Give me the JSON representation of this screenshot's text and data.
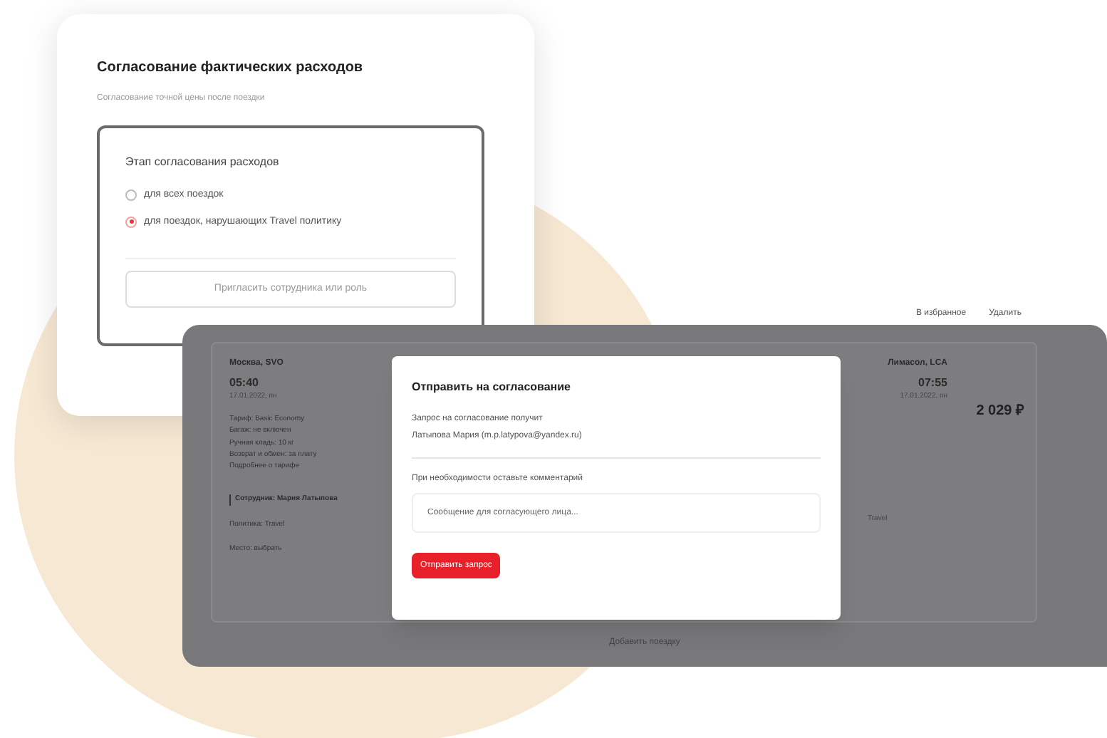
{
  "settings_card": {
    "title": "Согласование фактических расходов",
    "subtitle": "Согласование точной цены после поездки",
    "group_title": "Этап согласования расходов",
    "options": [
      {
        "label": "для всех поездок",
        "selected": false
      },
      {
        "label": "для поездок, нарушающих Travel политику",
        "selected": true
      }
    ],
    "invite_button": "Пригласить сотрудника или роль"
  },
  "trip_panel": {
    "top_actions": [
      "В избранное",
      "Удалить"
    ],
    "departure": {
      "city": "Москва, SVO",
      "time": "05:40",
      "date": "17.01.2022, пн"
    },
    "arrival": {
      "city": "Лимасол, LCA",
      "time": "07:55",
      "date": "17.01.2022, пн"
    },
    "price": "2 029 ₽",
    "details": [
      "Тариф: Basic Economy",
      "Багаж: не включен",
      "Ручная кладь: 10 кг",
      "Возврат и обмен: за плату"
    ],
    "details_link": "Подробнее о тарифе",
    "traveler": "Сотрудник: Мария Латыпова",
    "policy": "Политика: Travel",
    "seat": "Место: выбрать",
    "side_note": "Travel",
    "footer": "Добавить поездку"
  },
  "dialog": {
    "title": "Отправить на согласование",
    "recipient_label": "Запрос на согласование получит",
    "recipient": "Латыпова Мария (m.p.latypova@yandex.ru)",
    "comment_label": "При необходимости оставьте комментарий",
    "comment_placeholder": "Сообщение для согласующего лица...",
    "submit": "Отправить запрос"
  }
}
